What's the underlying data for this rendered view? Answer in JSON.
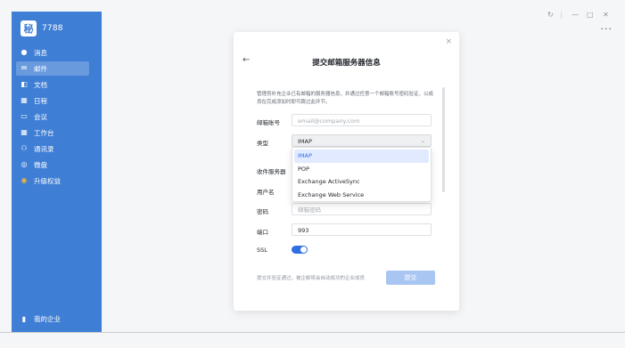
{
  "app": {
    "org_name": "7788",
    "avatar_char": "秘",
    "bottom_label": "我的企业"
  },
  "sidebar": {
    "items": [
      {
        "label": "消息",
        "icon": "chat-icon",
        "glyph": "●"
      },
      {
        "label": "邮件",
        "icon": "mail-icon",
        "glyph": "✉"
      },
      {
        "label": "文档",
        "icon": "document-icon",
        "glyph": "◧"
      },
      {
        "label": "日程",
        "icon": "calendar-icon",
        "glyph": "▦"
      },
      {
        "label": "会议",
        "icon": "video-icon",
        "glyph": "▭"
      },
      {
        "label": "工作台",
        "icon": "workspace-icon",
        "glyph": "▦"
      },
      {
        "label": "通讯录",
        "icon": "contacts-icon",
        "glyph": "⚇"
      },
      {
        "label": "微盘",
        "icon": "drive-icon",
        "glyph": "◎"
      },
      {
        "label": "升级权益",
        "icon": "upgrade-icon",
        "glyph": "◉"
      }
    ],
    "active_index": 1
  },
  "window": {
    "refresh_glyph": "↻",
    "minimize_glyph": "—",
    "maximize_glyph": "□",
    "close_glyph": "✕",
    "more_glyph": "···"
  },
  "dialog": {
    "title": "提交邮箱服务器信息",
    "back_glyph": "←",
    "close_glyph": "×",
    "description": "管理员补充企业已有邮箱的服务器信息，并通过任意一个邮箱账号密码验证，以成员在完成添加时即可跳过此环节。",
    "fields": {
      "email": {
        "label": "邮箱账号",
        "placeholder": "email@company.com"
      },
      "type": {
        "label": "类型",
        "value": "IMAP"
      },
      "incoming_server": {
        "label": "收件服务器"
      },
      "username": {
        "label": "用户名"
      },
      "password": {
        "label": "密码",
        "placeholder": "邮箱密码"
      },
      "port": {
        "label": "端口",
        "value": "993"
      },
      "ssl": {
        "label": "SSL",
        "enabled": true
      }
    },
    "footnote": "提交并验证通过，被企邮将会自动成功的企业成员",
    "submit_label": "提交"
  },
  "dropdown": {
    "options": [
      "IMAP",
      "POP",
      "Exchange ActiveSync",
      "Exchange Web Service"
    ],
    "selected": "IMAP"
  },
  "colors": {
    "sidebar_bg": "#3f7ed5",
    "accent": "#2f6fe4",
    "submit_disabled": "#a9c6f3"
  }
}
